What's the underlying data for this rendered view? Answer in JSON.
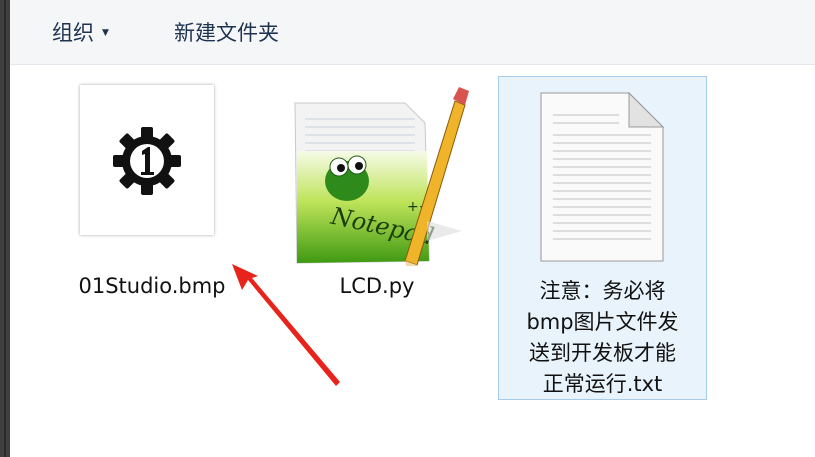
{
  "toolbar": {
    "organize_label": "组织",
    "new_folder_label": "新建文件夹"
  },
  "files": [
    {
      "name": "01Studio.bmp",
      "icon": "gear-1-bitmap-thumbnail"
    },
    {
      "name": "LCD.py",
      "icon": "notepad-plus-plus-icon"
    },
    {
      "name_lines": [
        "注意：务必将",
        "bmp图片文件发",
        "送到开发板才能",
        "正常运行.txt"
      ],
      "icon": "text-document-icon",
      "selected": true
    }
  ],
  "annotation": {
    "arrow_color": "#e8231c"
  },
  "colors": {
    "toolbar_text": "#1e3350",
    "selection_bg": "#e9f3fb",
    "selection_border": "#a7cbe6"
  }
}
